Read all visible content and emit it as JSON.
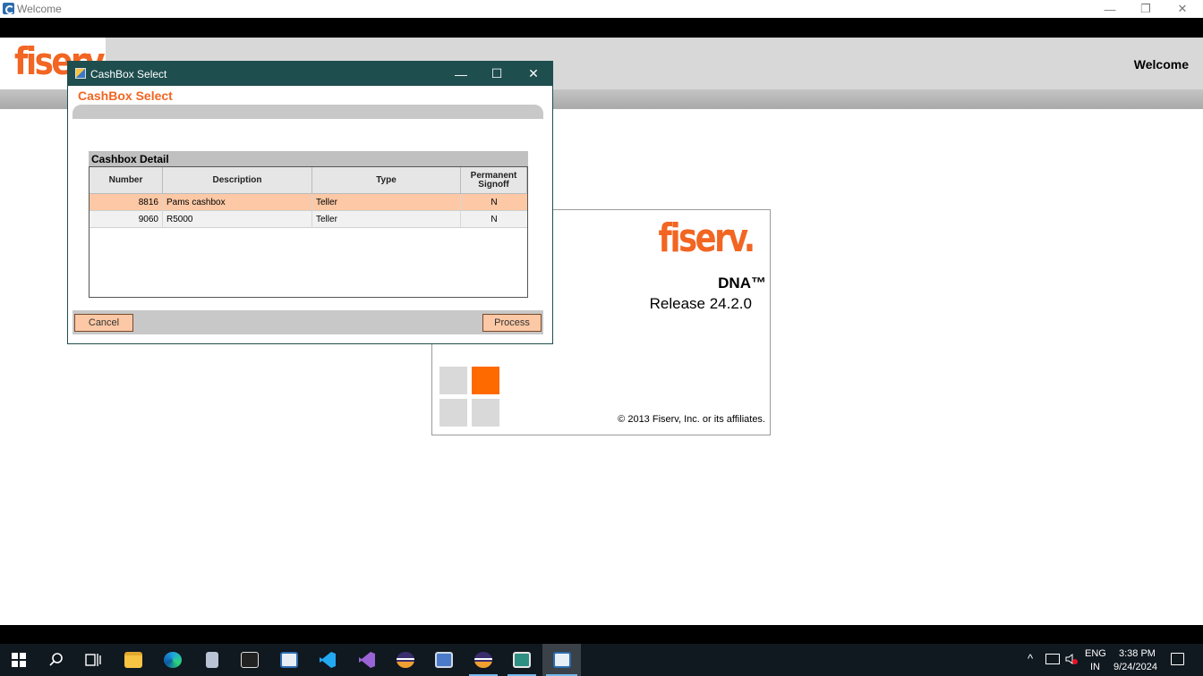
{
  "main_window": {
    "title": "Welcome",
    "controls": {
      "minimize": "—",
      "restore": "❐",
      "close": "✕"
    }
  },
  "header": {
    "logo": "fiserv.",
    "welcome": "Welcome"
  },
  "splash": {
    "logo": "fiserv.",
    "product": "DNA™",
    "release": "Release 24.2.0",
    "copyright": "© 2013 Fiserv, Inc. or its affiliates.",
    "accent_color": "#f26522"
  },
  "dialog": {
    "title": "CashBox Select",
    "heading": "CashBox Select",
    "controls": {
      "minimize": "—",
      "maximize": "☐",
      "close": "✕"
    },
    "detail_title": "Cashbox Detail",
    "columns": [
      "Number",
      "Description",
      "Type",
      "Permanent Signoff"
    ],
    "rows": [
      {
        "number": "8816",
        "description": "Pams cashbox",
        "type": "Teller",
        "signoff": "N"
      },
      {
        "number": "9060",
        "description": "R5000",
        "type": "Teller",
        "signoff": "N"
      }
    ],
    "cancel_label": "Cancel",
    "process_label": "Process"
  },
  "taskbar": {
    "tray": {
      "chevron": "^",
      "lang_top": "ENG",
      "lang_bottom": "IN",
      "time": "3:38 PM",
      "date": "9/24/2024"
    },
    "icons": [
      "start-icon",
      "search-icon",
      "task-view-icon",
      "file-explorer-icon",
      "edge-icon",
      "app-icon",
      "terminal-icon",
      "app-icon",
      "vscode-icon",
      "visual-studio-icon",
      "eclipse-icon",
      "app-icon",
      "eclipse-icon",
      "app-icon",
      "dna-app-icon"
    ]
  }
}
